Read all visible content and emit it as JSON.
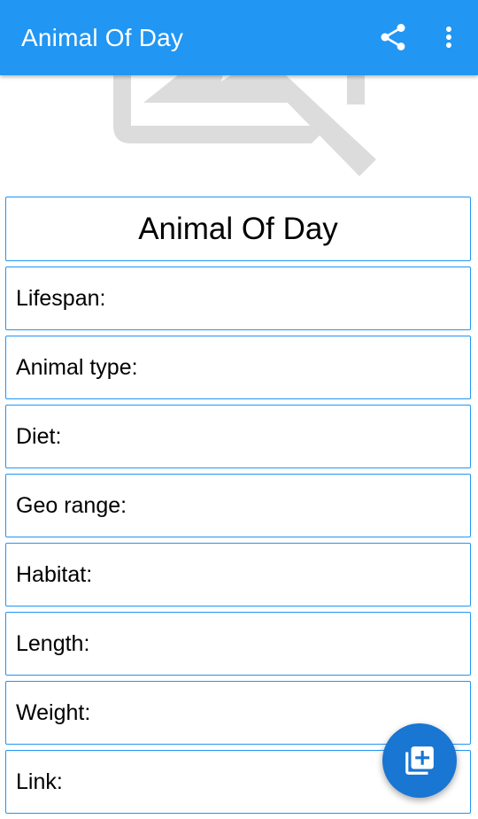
{
  "appbar": {
    "title": "Animal Of Day",
    "color": "#2196F3",
    "actions": [
      {
        "icon": "share-icon"
      },
      {
        "icon": "more-vert-icon"
      }
    ]
  },
  "hero": {
    "icon": "broken-image-icon",
    "color": "#dcdcdc"
  },
  "card_title": "Animal Of Day",
  "fields": [
    {
      "label": "Lifespan:"
    },
    {
      "label": "Animal type:"
    },
    {
      "label": "Diet:"
    },
    {
      "label": "Geo range:"
    },
    {
      "label": "Habitat:"
    },
    {
      "label": "Length:"
    },
    {
      "label": "Weight:"
    },
    {
      "label": "Link:"
    }
  ],
  "fab": {
    "icon": "add-to-library-icon",
    "color": "#1976D2"
  },
  "accent_border": "#2196F3"
}
